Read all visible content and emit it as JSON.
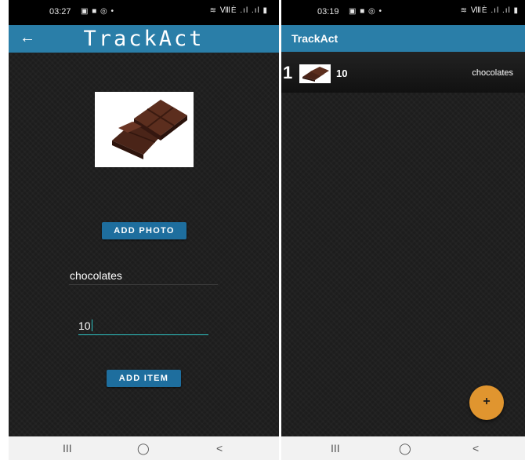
{
  "left_screen": {
    "status": {
      "time": "03:27",
      "icons": "▣ ■ ◎ •",
      "right": "≋ ⅧÈ .ıl .ıl ▮"
    },
    "app_bar": {
      "back_icon": "←",
      "title": "TrackAct"
    },
    "add_photo_label": "ADD PHOTO",
    "name_value": "chocolates",
    "quantity_value": "10",
    "add_item_label": "ADD ITEM"
  },
  "right_screen": {
    "status": {
      "time": "03:19",
      "icons": "▣ ■ ◎ •",
      "right": "≋ ⅧÈ .ıl .ıl ▮"
    },
    "app_bar": {
      "title": "TrackAct"
    },
    "list": [
      {
        "index": "1",
        "quantity": "10",
        "name": "chocolates"
      }
    ],
    "fab_label": "+"
  },
  "nav": {
    "recents": "III",
    "home": "◯",
    "back": "<"
  },
  "colors": {
    "app_bar": "#2a7ea8",
    "button": "#1e6e9e",
    "fab": "#e0952f",
    "accent": "#2ec4c4"
  }
}
